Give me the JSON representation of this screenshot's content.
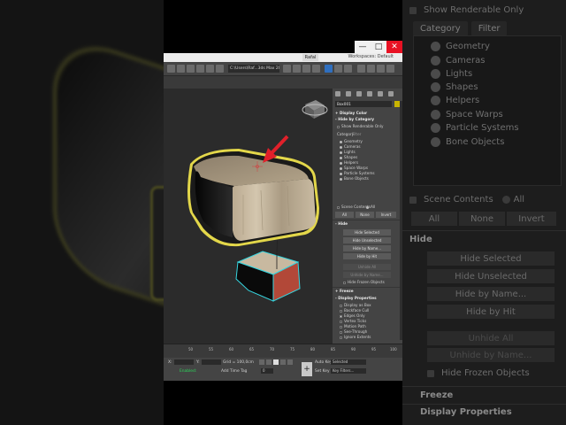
{
  "background_panel": {
    "show_renderable_only": "Show Renderable Only",
    "tabs": [
      "Category",
      "Filter"
    ],
    "categories": [
      "Geometry",
      "Cameras",
      "Lights",
      "Shapes",
      "Helpers",
      "Space Warps",
      "Particle Systems",
      "Bone Objects"
    ],
    "scene_contents": "Scene Contents",
    "all_radio": "All",
    "buttons": [
      "All",
      "None",
      "Invert"
    ],
    "hide_header": "Hide",
    "hide_buttons": [
      "Hide Selected",
      "Hide Unselected",
      "Hide by Name...",
      "Hide by Hit"
    ],
    "unhide_buttons": [
      "Unhide All",
      "Unhide by Name..."
    ],
    "hide_frozen": "Hide Frozen Objects",
    "freeze_header": "Freeze",
    "display_props_header": "Display Properties"
  },
  "window": {
    "controls": [
      "—",
      "□",
      "✕"
    ],
    "title_badge": "Rafal",
    "workspace": "Workspaces: Default",
    "path": "C:\\Users\\Raf...3ds Max 2020"
  },
  "command_panel": {
    "object_name": "Box001",
    "display_color": "Display Color",
    "hide_by_category": "Hide by Category",
    "show_renderable_only": "Show Renderable Only",
    "tabs": [
      "Category",
      "Filter"
    ],
    "categories": [
      "Geometry",
      "Cameras",
      "Lights",
      "Shapes",
      "Helpers",
      "Space Warps",
      "Particle Systems",
      "Bone Objects"
    ],
    "scene_contents": "Scene Contents",
    "all_radio": "All",
    "buttons": [
      "All",
      "None",
      "Invert"
    ],
    "hide_header": "Hide",
    "hide_buttons": [
      "Hide Selected",
      "Hide Unselected",
      "Hide by Name...",
      "Hide by Hit"
    ],
    "unhide_buttons": [
      "Unhide All",
      "Unhide by Name..."
    ],
    "hide_frozen": "Hide Frozen Objects",
    "freeze_header": "Freeze",
    "display_props_header": "Display Properties",
    "display_props": [
      "Display as Box",
      "Backface Cull",
      "Edges Only",
      "Vertex Ticks",
      "Motion Path",
      "See-Through",
      "Ignore Extents"
    ]
  },
  "timeline": {
    "ticks": [
      "50",
      "55",
      "60",
      "65",
      "70",
      "75",
      "80",
      "85",
      "90",
      "95",
      "100"
    ]
  },
  "status": {
    "x_label": "X:",
    "y_label": "Y:",
    "grid": "Grid = 100,0cm",
    "enabled": "Enabled:",
    "add_time_tag": "Add Time Tag",
    "auto_key": "Auto Key",
    "selected": "Selected",
    "set_key": "Set Key",
    "key_filters": "Key Filters...",
    "frame": "0"
  },
  "colors": {
    "selection_yellow": "#e3d74a",
    "selection_cyan": "#36d6e0",
    "arrow_red": "#e0202a",
    "viewport_bg": "#2b2b2b"
  }
}
